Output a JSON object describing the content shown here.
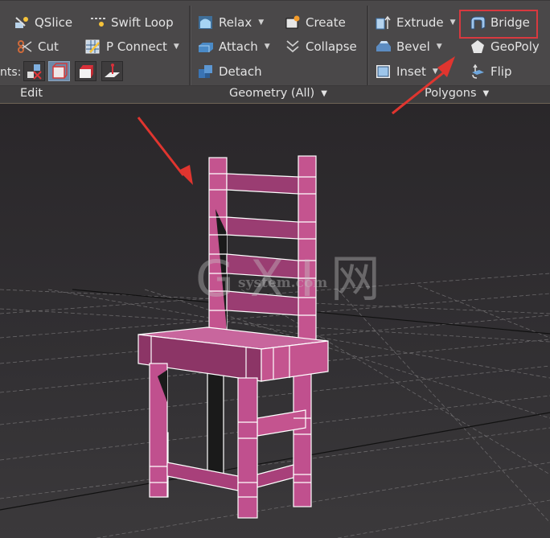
{
  "ribbon": {
    "edit_group": {
      "label": "Edit",
      "items": [
        {
          "label": "QSlice",
          "icon": "qslice-icon"
        },
        {
          "label": "Swift Loop",
          "icon": "swift-loop-icon"
        },
        {
          "label": "Cut",
          "icon": "cut-scissors-icon"
        },
        {
          "label": "P Connect",
          "icon": "p-connect-icon",
          "has_dropdown": true
        }
      ],
      "constraints_label": "nts:",
      "constraint_buttons": [
        {
          "name": "constraint-none",
          "icon": "constraint-none-icon",
          "active": false
        },
        {
          "name": "constraint-edge",
          "icon": "constraint-edge-icon",
          "active": true
        },
        {
          "name": "constraint-face",
          "icon": "constraint-face-icon",
          "active": false
        },
        {
          "name": "constraint-normal",
          "icon": "constraint-normal-icon",
          "active": false
        }
      ]
    },
    "geometry_group": {
      "label": "Geometry (All)",
      "items": [
        {
          "label": "Relax",
          "icon": "relax-icon",
          "has_dropdown": true
        },
        {
          "label": "Create",
          "icon": "create-icon"
        },
        {
          "label": "Attach",
          "icon": "attach-icon",
          "has_dropdown": true
        },
        {
          "label": "Collapse",
          "icon": "collapse-icon"
        },
        {
          "label": "Detach",
          "icon": "detach-icon"
        }
      ]
    },
    "polygons_group": {
      "label": "Polygons",
      "items": [
        {
          "label": "Extrude",
          "icon": "extrude-icon",
          "has_dropdown": true
        },
        {
          "label": "Bridge",
          "icon": "bridge-icon",
          "highlighted": true
        },
        {
          "label": "Bevel",
          "icon": "bevel-icon",
          "has_dropdown": true
        },
        {
          "label": "GeoPoly",
          "icon": "geopoly-icon"
        },
        {
          "label": "Inset",
          "icon": "inset-icon",
          "has_dropdown": true
        },
        {
          "label": "Flip",
          "icon": "flip-icon"
        }
      ]
    },
    "dropdown_glyph": "▼"
  },
  "viewport": {
    "object": "chair-mesh",
    "object_color": "#c0508e",
    "wire_color": "#ffffff",
    "watermark": {
      "logo": "G X I 网",
      "site": "system.com"
    }
  },
  "annotations": {
    "highlight_color": "#d8393f",
    "arrow_color": "#e0352f"
  }
}
